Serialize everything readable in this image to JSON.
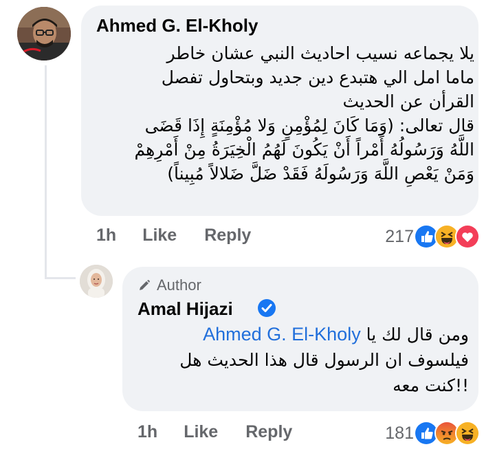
{
  "comment": {
    "author": "Ahmed G. El-Kholy",
    "text_lines": [
      "يلا يجماعه نسيب احاديث النبي عشان خاطر",
      "ماما امل الي هتبدع دين جديد وبتحاول تفصل",
      "القرأن عن الحديث",
      "قال تعالى: (وَمَا كَانَ لِمُؤْمِنٍ وَلا مُؤْمِنَةٍ إِذَا قَضَى",
      "اللَّهُ وَرَسُولُهُ أَمْراً أَنْ يَكُونَ لَهُمُ الْخِيَرَةُ مِنْ أَمْرِهِمْ",
      "وَمَنْ يَعْصِ اللَّهَ وَرَسُولَهُ فَقَدْ ضَلَّ ضَلالاً مُبِيناً)"
    ],
    "time": "1h",
    "like_label": "Like",
    "reply_label": "Reply",
    "reaction_count": "217",
    "reactions": [
      "like-icon",
      "haha-icon",
      "love-icon"
    ]
  },
  "reply": {
    "badge": "Author",
    "author": "Amal Hijazi",
    "mention": "Ahmed G. El-Kholy",
    "text_after_mention": "ومن قال لك يا",
    "text_lines": [
      "فيلسوف ان الرسول قال هذا الحديث هل",
      "!!كنت معه"
    ],
    "time": "1h",
    "like_label": "Like",
    "reply_label": "Reply",
    "reaction_count": "181",
    "reactions": [
      "like-icon",
      "angry-icon",
      "haha-icon"
    ]
  },
  "colors": {
    "bubble": "#f0f2f5",
    "meta_text": "#65676b",
    "mention": "#216fdb",
    "like_blue": "#1877f2",
    "love_red": "#f33e58",
    "haha_yellow": "#f7b125"
  }
}
